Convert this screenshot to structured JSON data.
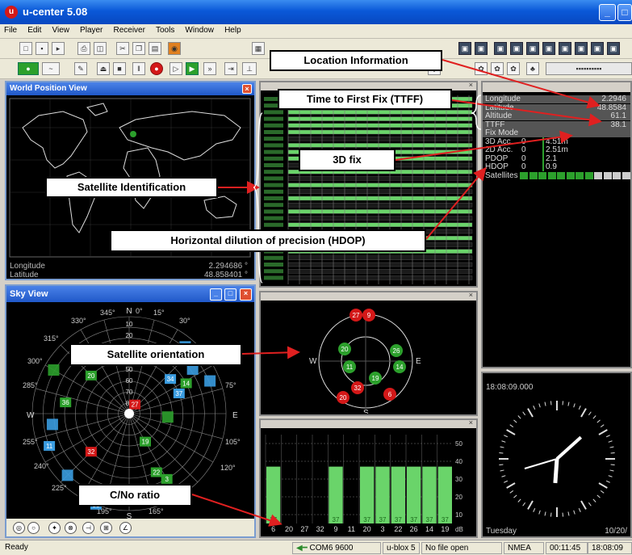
{
  "window": {
    "title": "u-center 5.08",
    "icon_letter": "u"
  },
  "menu": [
    "File",
    "Edit",
    "View",
    "Player",
    "Receiver",
    "Tools",
    "Window",
    "Help"
  ],
  "world_view": {
    "title": "World Position View",
    "longitude_label": "Longitude",
    "longitude_value": "2.294686 °",
    "latitude_label": "Latitude",
    "latitude_value": "48.858401 °"
  },
  "sky_view": {
    "title": "Sky View",
    "compass": {
      "n": "N",
      "s": "S",
      "e": "E",
      "w": "W"
    },
    "azimuth_labels": [
      "0°",
      "15°",
      "30°",
      "75°",
      "105°",
      "120°",
      "165°",
      "195°",
      "225°",
      "240°",
      "255°",
      "285°",
      "300°",
      "315°",
      "330°",
      "345°"
    ],
    "elevation_labels": [
      "10",
      "20",
      "30",
      "40",
      "50",
      "60",
      "70",
      "80"
    ],
    "satellites": [
      "26",
      "20",
      "14",
      "37",
      "34",
      "11",
      "36",
      "19",
      "27",
      "32",
      "22",
      "3",
      "33"
    ]
  },
  "nav_info": {
    "rows": [
      {
        "label": "Longitude",
        "value": "2.2946"
      },
      {
        "label": "Latitude",
        "value": "48.8584"
      },
      {
        "label": "Altitude",
        "value": "61.1"
      },
      {
        "label": "TTFF",
        "value": "38.1"
      },
      {
        "label": "Fix Mode",
        "value": ""
      },
      {
        "label": "3D Acc.",
        "value": "0",
        "value2": "4.51m"
      },
      {
        "label": "2D Acc.",
        "value": "0",
        "value2": "2.51m"
      },
      {
        "label": "PDOP",
        "value": "0",
        "value2": "2.1"
      },
      {
        "label": "HDOP",
        "value": "0",
        "value2": "0.9"
      },
      {
        "label": "Satellites",
        "value": ""
      }
    ]
  },
  "orientation_view": {
    "e": "E",
    "w": "W",
    "s": "S",
    "satellites": [
      "27",
      "9",
      "20",
      "26",
      "11",
      "14",
      "19",
      "32",
      "20",
      "6"
    ]
  },
  "clock": {
    "time": "18:08:09.000",
    "day": "Tuesday",
    "date": "10/20/"
  },
  "cno_chart": {
    "y_ticks": [
      "50",
      "40",
      "30",
      "20",
      "10"
    ],
    "bars": [
      {
        "sv": "6",
        "value": 37
      },
      {
        "sv": "20",
        "value": 0
      },
      {
        "sv": "27",
        "value": 0
      },
      {
        "sv": "32",
        "value": 0
      },
      {
        "sv": "9",
        "value": 37
      },
      {
        "sv": "11",
        "value": 0
      },
      {
        "sv": "20",
        "value": 37
      },
      {
        "sv": "3",
        "value": 37
      },
      {
        "sv": "22",
        "value": 37
      },
      {
        "sv": "26",
        "value": 37
      },
      {
        "sv": "14",
        "value": 37
      },
      {
        "sv": "19",
        "value": 37
      }
    ],
    "unit": "dB"
  },
  "callouts": {
    "location": "Location Information",
    "ttff": "Time to First Fix (TTFF)",
    "fix3d": "3D fix",
    "sat_id": "Satellite Identification",
    "hdop": "Horizontal dilution of precision (HDOP)",
    "orientation": "Satellite orientation",
    "cno": "C/No ratio"
  },
  "status": {
    "ready": "Ready",
    "port": "COM6 9600",
    "device": "u-blox 5",
    "file": "No file open",
    "protocol": "NMEA",
    "elapsed": "00:11:45",
    "time": "18:08:09"
  }
}
